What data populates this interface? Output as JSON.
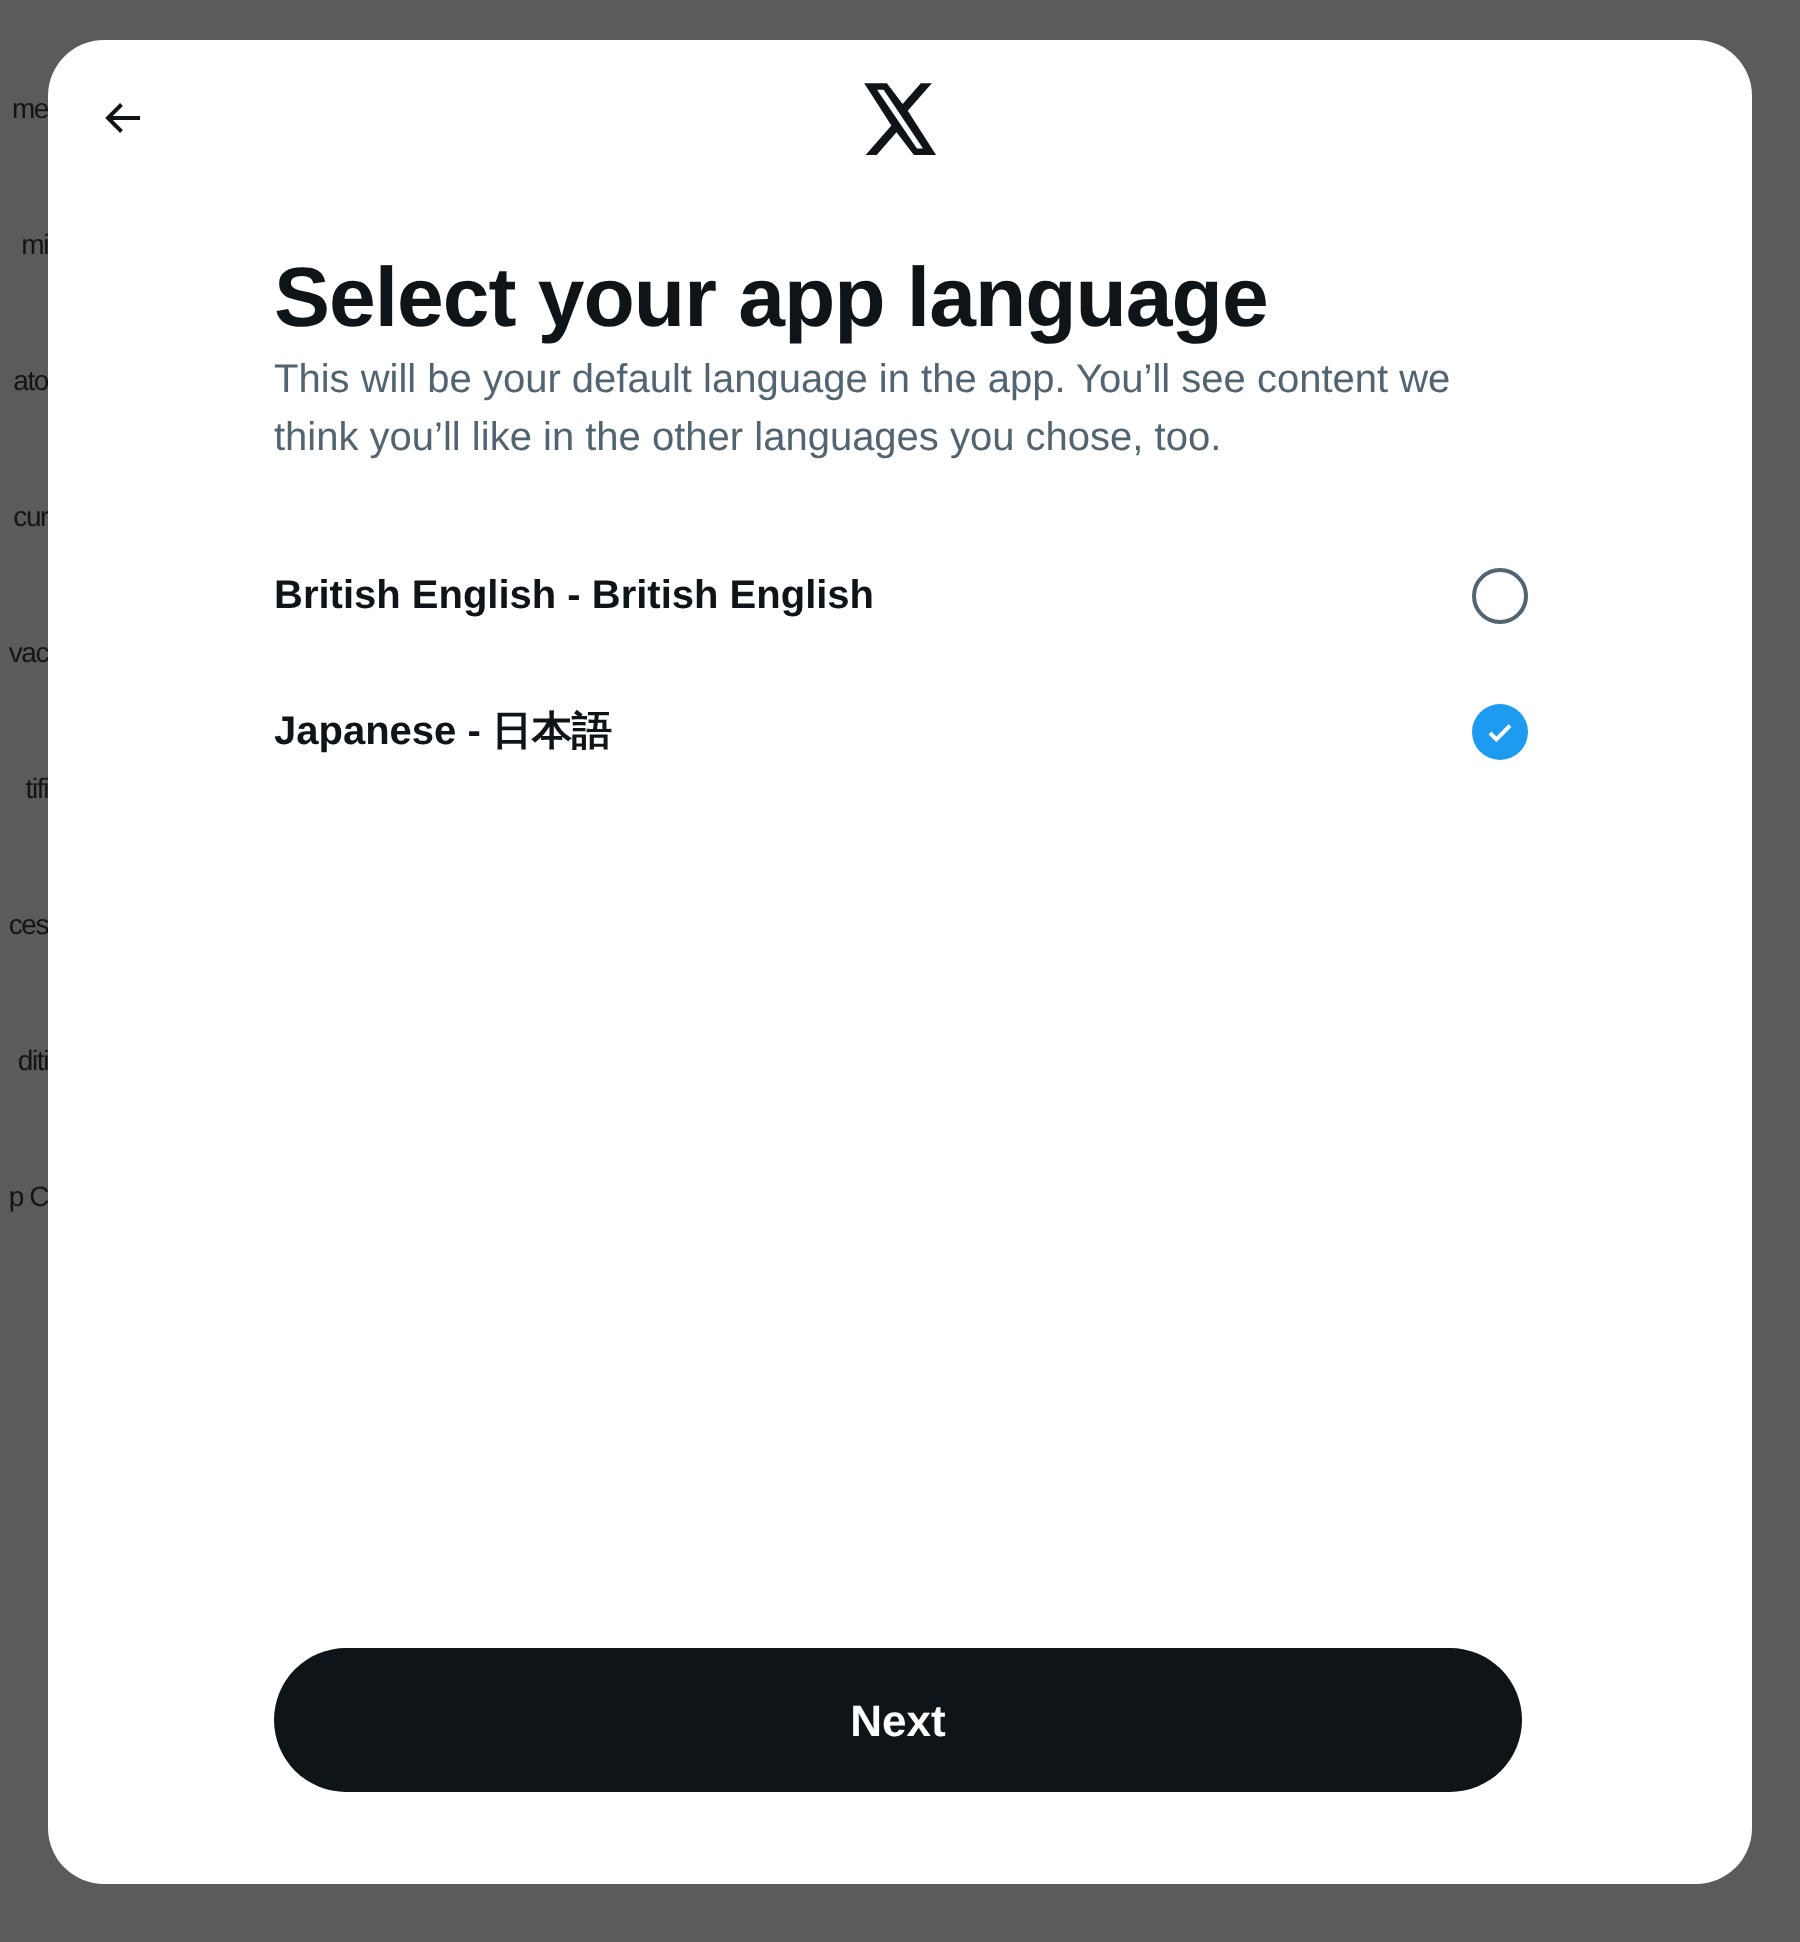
{
  "background_items": [
    "me",
    "mi",
    "ato",
    "cur",
    "vac",
    "tifi",
    "ces",
    "diti",
    "p C"
  ],
  "dialog": {
    "title": "Select your app language",
    "description": "This will be your default language in the app. You’ll see content we think you’ll like in the other languages you chose, too.",
    "options": [
      {
        "label": "British English - British English",
        "selected": false
      },
      {
        "label": "Japanese - 日本語",
        "selected": true
      }
    ],
    "button": "Next"
  }
}
